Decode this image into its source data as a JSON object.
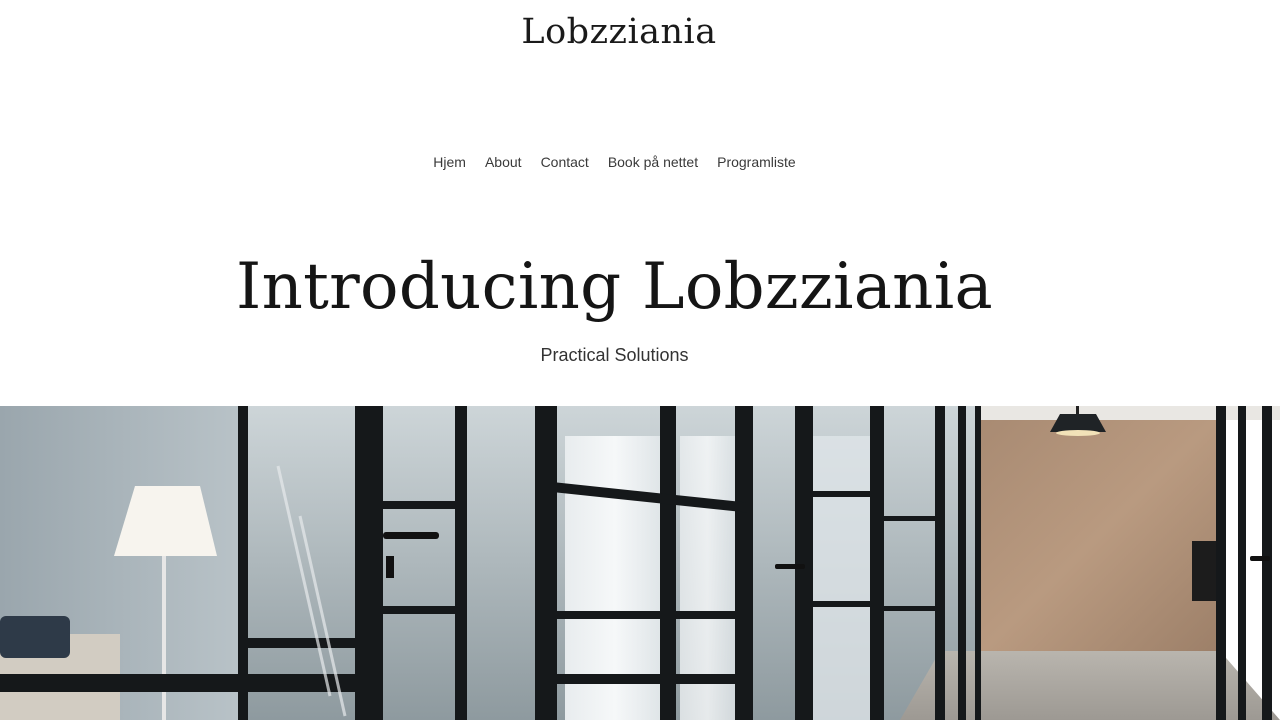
{
  "site": {
    "title": "Lobzziania"
  },
  "nav": {
    "items": [
      {
        "label": "Hjem"
      },
      {
        "label": "About"
      },
      {
        "label": "Contact"
      },
      {
        "label": "Book på nettet"
      },
      {
        "label": "Programliste"
      }
    ]
  },
  "hero": {
    "heading": "Introducing Lobzziania",
    "subheading": "Practical Solutions"
  },
  "image": {
    "subject": "office-corridor-photo"
  }
}
